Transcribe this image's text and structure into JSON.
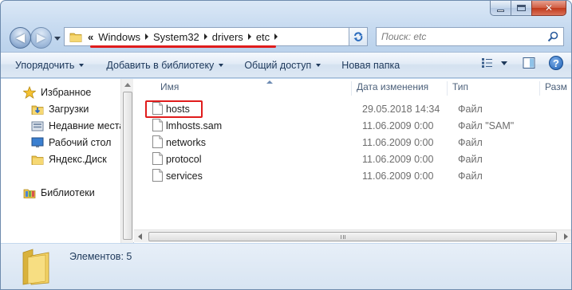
{
  "window": {
    "caption_buttons": {
      "minimize": "minimize",
      "maximize": "maximize",
      "close": "✕"
    }
  },
  "address_bar": {
    "overflow_chevron": "«",
    "breadcrumbs": [
      "Windows",
      "System32",
      "drivers",
      "etc"
    ]
  },
  "search": {
    "placeholder": "Поиск: etc"
  },
  "toolbar": {
    "organize": "Упорядочить",
    "add_to_library": "Добавить в библиотеку",
    "share": "Общий доступ",
    "new_folder": "Новая папка",
    "help": "?"
  },
  "sidebar": {
    "favorites": "Избранное",
    "items": [
      "Загрузки",
      "Недавние места",
      "Рабочий стол",
      "Яндекс.Диск"
    ],
    "libraries": "Библиотеки"
  },
  "columns": {
    "name": "Имя",
    "date": "Дата изменения",
    "type": "Тип",
    "size": "Разм"
  },
  "files": [
    {
      "name": "hosts",
      "date": "29.05.2018 14:34",
      "type": "Файл"
    },
    {
      "name": "lmhosts.sam",
      "date": "11.06.2009 0:00",
      "type": "Файл \"SAM\""
    },
    {
      "name": "networks",
      "date": "11.06.2009 0:00",
      "type": "Файл"
    },
    {
      "name": "protocol",
      "date": "11.06.2009 0:00",
      "type": "Файл"
    },
    {
      "name": "services",
      "date": "11.06.2009 0:00",
      "type": "Файл"
    }
  ],
  "details": {
    "count_text": "Элементов: 5"
  },
  "colors": {
    "highlight_red": "#e01c1c",
    "toolbar_text": "#1e395b",
    "folder_yellow": "#f2cf5b"
  },
  "icons": [
    "folder-icon",
    "star-icon",
    "downloads-icon",
    "recent-places-icon",
    "desktop-icon",
    "libraries-icon",
    "file-icon",
    "search-icon",
    "refresh-icon",
    "view-options-icon",
    "preview-pane-icon",
    "help-icon"
  ]
}
